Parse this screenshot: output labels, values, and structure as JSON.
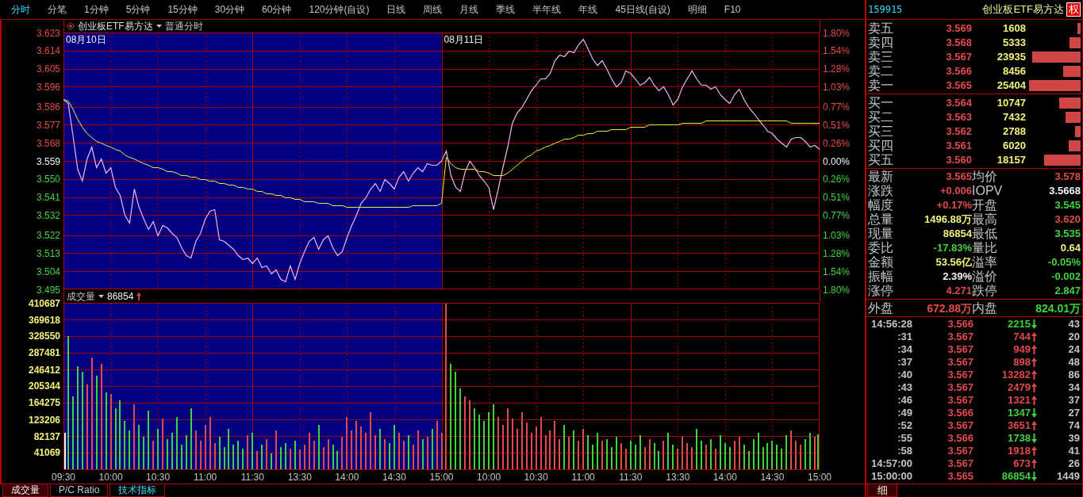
{
  "toolbar": {
    "tabs": [
      {
        "label": "分时",
        "selected": true
      },
      {
        "label": "分笔",
        "selected": false
      },
      {
        "label": "1分钟",
        "selected": false
      },
      {
        "label": "5分钟",
        "selected": false
      },
      {
        "label": "15分钟",
        "selected": false
      },
      {
        "label": "30分钟",
        "selected": false
      },
      {
        "label": "60分钟",
        "selected": false
      },
      {
        "label": "120分钟(自设)",
        "selected": false
      },
      {
        "label": "日线",
        "selected": false
      },
      {
        "label": "周线",
        "selected": false
      },
      {
        "label": "月线",
        "selected": false
      },
      {
        "label": "季线",
        "selected": false
      },
      {
        "label": "半年线",
        "selected": false
      },
      {
        "label": "年线",
        "selected": false
      },
      {
        "label": "45日线(自设)",
        "selected": false
      },
      {
        "label": "明细",
        "selected": false
      },
      {
        "label": "F10",
        "selected": false
      }
    ]
  },
  "price_panel": {
    "title": "创业板ETF易方达",
    "mode": "普通分时",
    "sessions": [
      {
        "date": "08月10日",
        "shaded": true
      },
      {
        "date": "08月11日",
        "shaded": false
      }
    ],
    "percent_ticks": [
      {
        "label": "1.80%",
        "kind": "rise"
      },
      {
        "label": "1.54%",
        "kind": "rise"
      },
      {
        "label": "1.28%",
        "kind": "rise"
      },
      {
        "label": "1.03%",
        "kind": "rise"
      },
      {
        "label": "0.77%",
        "kind": "rise"
      },
      {
        "label": "0.51%",
        "kind": "rise"
      },
      {
        "label": "0.26%",
        "kind": "rise"
      },
      {
        "label": "0.00%",
        "kind": "flat"
      },
      {
        "label": "0.26%",
        "kind": "fall"
      },
      {
        "label": "0.51%",
        "kind": "fall"
      },
      {
        "label": "0.77%",
        "kind": "fall"
      },
      {
        "label": "1.03%",
        "kind": "fall"
      },
      {
        "label": "1.28%",
        "kind": "fall"
      },
      {
        "label": "1.54%",
        "kind": "fall"
      },
      {
        "label": "1.80%",
        "kind": "fall"
      }
    ],
    "chart_data": {
      "type": "line",
      "grid": true,
      "ylim": [
        3.495,
        3.623
      ],
      "yticks": [
        {
          "value": 3.623,
          "label": "3.623"
        },
        {
          "value": 3.614,
          "label": "3.614"
        },
        {
          "value": 3.605,
          "label": "3.605"
        },
        {
          "value": 3.596,
          "label": "3.596"
        },
        {
          "value": 3.586,
          "label": "3.586"
        },
        {
          "value": 3.577,
          "label": "3.577"
        },
        {
          "value": 3.568,
          "label": "3.568"
        },
        {
          "value": 3.559,
          "label": "3.559"
        },
        {
          "value": 3.55,
          "label": "3.550"
        },
        {
          "value": 3.541,
          "label": "3.541"
        },
        {
          "value": 3.532,
          "label": "3.532"
        },
        {
          "value": 3.522,
          "label": "3.522"
        },
        {
          "value": 3.513,
          "label": "3.513"
        },
        {
          "value": 3.504,
          "label": "3.504"
        },
        {
          "value": 3.495,
          "label": "3.495"
        }
      ],
      "categories": [
        null,
        null,
        null,
        null,
        null,
        null,
        null,
        null,
        null,
        null,
        null,
        null,
        null,
        null,
        null,
        null,
        null,
        null,
        null,
        null,
        null,
        null,
        null,
        null,
        null,
        null,
        null,
        null,
        null,
        null,
        null,
        null,
        null,
        null,
        null,
        null,
        null,
        null,
        null,
        null,
        null,
        null,
        null,
        null,
        null,
        null,
        null,
        null,
        null,
        null,
        null,
        null,
        null,
        null,
        null,
        null,
        null,
        null,
        null,
        null,
        null,
        null,
        null,
        null,
        null,
        null,
        null,
        null,
        null,
        null,
        null,
        null,
        null,
        null,
        null,
        null,
        null,
        null,
        null,
        null,
        null,
        null,
        null,
        null,
        null,
        null,
        null,
        null,
        null,
        null,
        null,
        null,
        null,
        null,
        null,
        null,
        null,
        null,
        null,
        null,
        null,
        null,
        null,
        null,
        null,
        null,
        null,
        null,
        null,
        null,
        null,
        null,
        null,
        null,
        null,
        null,
        null,
        null,
        null,
        null,
        null,
        null,
        null,
        null,
        null,
        null,
        null,
        null,
        null,
        null,
        null,
        null,
        null,
        null,
        null,
        null,
        null,
        null,
        null,
        null,
        null,
        null,
        null,
        null,
        null,
        null,
        null,
        null,
        null,
        null,
        null,
        null,
        null,
        null,
        null,
        null,
        null,
        null,
        null,
        null,
        null
      ],
      "series": [
        {
          "color": "#f4b4f4",
          "values": [
            3.59,
            3.588,
            3.572,
            3.555,
            3.549,
            3.56,
            3.566,
            3.556,
            3.56,
            3.553,
            3.556,
            3.546,
            3.542,
            3.532,
            3.528,
            3.545,
            3.536,
            3.53,
            3.525,
            3.529,
            3.522,
            3.527,
            3.526,
            3.523,
            3.521,
            3.516,
            3.512,
            3.511,
            3.519,
            3.523,
            3.53,
            3.534,
            3.535,
            3.52,
            3.519,
            3.517,
            3.515,
            3.512,
            3.51,
            3.511,
            3.508,
            3.511,
            3.506,
            3.507,
            3.503,
            3.505,
            3.5,
            3.499,
            3.507,
            3.5,
            3.508,
            3.514,
            3.519,
            3.521,
            3.515,
            3.52,
            3.522,
            3.516,
            3.512,
            3.514,
            3.521,
            3.527,
            3.532,
            3.538,
            3.541,
            3.545,
            3.548,
            3.544,
            3.55,
            3.548,
            3.545,
            3.551,
            3.554,
            3.549,
            3.553,
            3.556,
            3.554,
            3.558,
            3.557,
            3.557,
            3.559,
            3.564,
            3.552,
            3.546,
            3.544,
            3.554,
            3.559,
            3.556,
            3.552,
            3.549,
            3.546,
            3.535,
            3.545,
            3.556,
            3.566,
            3.578,
            3.583,
            3.586,
            3.59,
            3.594,
            3.597,
            3.6,
            3.6,
            3.603,
            3.609,
            3.612,
            3.611,
            3.614,
            3.613,
            3.617,
            3.62,
            3.615,
            3.61,
            3.607,
            3.609,
            3.605,
            3.6,
            3.596,
            3.598,
            3.604,
            3.603,
            3.6,
            3.597,
            3.598,
            3.601,
            3.597,
            3.594,
            3.596,
            3.592,
            3.587,
            3.59,
            3.596,
            3.6,
            3.604,
            3.6,
            3.597,
            3.597,
            3.595,
            3.596,
            3.592,
            3.59,
            3.588,
            3.592,
            3.595,
            3.59,
            3.586,
            3.583,
            3.58,
            3.577,
            3.574,
            3.573,
            3.57,
            3.568,
            3.566,
            3.57,
            3.571,
            3.571,
            3.569,
            3.566,
            3.567,
            3.565
          ]
        },
        {
          "color": "#f0f040",
          "values": [
            3.59,
            3.589,
            3.585,
            3.58,
            3.576,
            3.573,
            3.571,
            3.569,
            3.568,
            3.567,
            3.566,
            3.565,
            3.564,
            3.562,
            3.561,
            3.56,
            3.559,
            3.558,
            3.557,
            3.556,
            3.556,
            3.555,
            3.554,
            3.554,
            3.553,
            3.552,
            3.552,
            3.551,
            3.551,
            3.55,
            3.55,
            3.549,
            3.549,
            3.548,
            3.548,
            3.547,
            3.547,
            3.546,
            3.546,
            3.545,
            3.545,
            3.544,
            3.544,
            3.543,
            3.543,
            3.542,
            3.542,
            3.541,
            3.541,
            3.54,
            3.54,
            3.539,
            3.539,
            3.539,
            3.538,
            3.538,
            3.538,
            3.537,
            3.537,
            3.537,
            3.536,
            3.536,
            3.536,
            3.536,
            3.536,
            3.536,
            3.536,
            3.536,
            3.536,
            3.536,
            3.536,
            3.536,
            3.536,
            3.536,
            3.537,
            3.537,
            3.537,
            3.537,
            3.537,
            3.537,
            3.538,
            3.561,
            3.558,
            3.556,
            3.555,
            3.555,
            3.555,
            3.555,
            3.554,
            3.554,
            3.553,
            3.552,
            3.552,
            3.552,
            3.553,
            3.555,
            3.557,
            3.559,
            3.561,
            3.562,
            3.564,
            3.565,
            3.566,
            3.567,
            3.568,
            3.569,
            3.57,
            3.57,
            3.571,
            3.572,
            3.572,
            3.573,
            3.573,
            3.574,
            3.574,
            3.574,
            3.575,
            3.575,
            3.575,
            3.575,
            3.576,
            3.576,
            3.576,
            3.576,
            3.577,
            3.577,
            3.577,
            3.577,
            3.577,
            3.577,
            3.577,
            3.578,
            3.578,
            3.578,
            3.578,
            3.578,
            3.579,
            3.579,
            3.579,
            3.579,
            3.579,
            3.579,
            3.579,
            3.579,
            3.579,
            3.579,
            3.579,
            3.579,
            3.579,
            3.579,
            3.579,
            3.579,
            3.579,
            3.579,
            3.578,
            3.578,
            3.578,
            3.578,
            3.578,
            3.578,
            3.578
          ]
        }
      ]
    }
  },
  "volume_panel": {
    "title": "成交量",
    "value": "86854",
    "chart_data": {
      "type": "bar",
      "grid": true,
      "ylim": [
        0,
        410687
      ],
      "yticks": [
        410687,
        369618,
        328550,
        287481,
        246412,
        205344,
        164275,
        123206,
        82137,
        41069
      ],
      "categories": [
        "09:30",
        null,
        null,
        null,
        null,
        null,
        null,
        null,
        null,
        null,
        "10:00",
        null,
        null,
        null,
        null,
        null,
        null,
        null,
        null,
        null,
        "10:30",
        null,
        null,
        null,
        null,
        null,
        null,
        null,
        null,
        null,
        "11:00",
        null,
        null,
        null,
        null,
        null,
        null,
        null,
        null,
        null,
        "11:30",
        null,
        null,
        null,
        null,
        null,
        null,
        null,
        null,
        null,
        "13:30",
        null,
        null,
        null,
        null,
        null,
        null,
        null,
        null,
        null,
        "14:00",
        null,
        null,
        null,
        null,
        null,
        null,
        null,
        null,
        null,
        "14:30",
        null,
        null,
        null,
        null,
        null,
        null,
        null,
        null,
        null,
        "15:00",
        null,
        null,
        null,
        null,
        null,
        null,
        null,
        null,
        null,
        "10:00",
        null,
        null,
        null,
        null,
        null,
        null,
        null,
        null,
        null,
        "10:30",
        null,
        null,
        null,
        null,
        null,
        null,
        null,
        null,
        null,
        "11:00",
        null,
        null,
        null,
        null,
        null,
        null,
        null,
        null,
        null,
        "11:30",
        null,
        null,
        null,
        null,
        null,
        null,
        null,
        null,
        null,
        "13:30",
        null,
        null,
        null,
        null,
        null,
        null,
        null,
        null,
        null,
        "14:00",
        null,
        null,
        null,
        null,
        null,
        null,
        null,
        null,
        null,
        "14:30",
        null,
        null,
        null,
        null,
        null,
        null,
        null,
        null,
        null,
        "15:00"
      ],
      "series": [
        {
          "color": "#e34a4a",
          "values": [
            null,
            null,
            null,
            null,
            null,
            210000,
            275000,
            null,
            260000,
            null,
            185000,
            null,
            null,
            null,
            null,
            160000,
            null,
            null,
            null,
            70000,
            null,
            125000,
            null,
            null,
            null,
            null,
            null,
            null,
            95000,
            70000,
            110000,
            130000,
            65000,
            null,
            null,
            null,
            null,
            null,
            null,
            85000,
            null,
            45000,
            null,
            75000,
            null,
            95000,
            null,
            null,
            50000,
            null,
            48000,
            60000,
            90000,
            70000,
            null,
            55000,
            75000,
            null,
            null,
            80000,
            130000,
            95000,
            120000,
            105000,
            90000,
            140000,
            85000,
            null,
            75000,
            null,
            null,
            90000,
            70000,
            null,
            60000,
            95000,
            null,
            80000,
            null,
            120000,
            90000,
            410000,
            null,
            null,
            null,
            180000,
            170000,
            null,
            null,
            null,
            null,
            null,
            130000,
            110000,
            150000,
            125000,
            100000,
            140000,
            115000,
            90000,
            105000,
            130000,
            85000,
            95000,
            120000,
            75000,
            null,
            80000,
            null,
            70000,
            100000,
            null,
            null,
            null,
            70000,
            null,
            null,
            null,
            65000,
            50000,
            null,
            null,
            null,
            55000,
            75000,
            null,
            null,
            70000,
            null,
            null,
            50000,
            80000,
            65000,
            55000,
            null,
            null,
            60000,
            null,
            50000,
            null,
            null,
            null,
            70000,
            80000,
            null,
            null,
            null,
            null,
            null,
            null,
            null,
            null,
            null,
            null,
            95000,
            70000,
            60000,
            null,
            null,
            80000,
            null
          ]
        },
        {
          "color": "#3fd23f",
          "values": [
            null,
            328000,
            180000,
            255000,
            240000,
            null,
            null,
            230000,
            null,
            190000,
            null,
            150000,
            170000,
            120000,
            95000,
            null,
            110000,
            80000,
            145000,
            null,
            100000,
            null,
            75000,
            90000,
            130000,
            60000,
            85000,
            150000,
            null,
            null,
            null,
            null,
            null,
            80000,
            55000,
            100000,
            60000,
            70000,
            50000,
            null,
            90000,
            null,
            60000,
            null,
            40000,
            null,
            55000,
            65000,
            null,
            70000,
            null,
            null,
            null,
            null,
            110000,
            null,
            null,
            60000,
            45000,
            null,
            null,
            null,
            null,
            null,
            null,
            null,
            null,
            100000,
            null,
            65000,
            110000,
            null,
            null,
            85000,
            null,
            null,
            75000,
            null,
            100000,
            null,
            null,
            null,
            260000,
            240000,
            200000,
            null,
            null,
            150000,
            135000,
            120000,
            140000,
            160000,
            null,
            null,
            null,
            null,
            null,
            null,
            null,
            null,
            null,
            null,
            null,
            null,
            null,
            null,
            110000,
            null,
            95000,
            null,
            null,
            85000,
            60000,
            90000,
            null,
            75000,
            55000,
            80000,
            null,
            null,
            70000,
            60000,
            85000,
            null,
            null,
            65000,
            45000,
            null,
            90000,
            60000,
            null,
            null,
            null,
            null,
            100000,
            70000,
            null,
            75000,
            null,
            85000,
            65000,
            55000,
            null,
            null,
            60000,
            45000,
            75000,
            90000,
            55000,
            65000,
            70000,
            60000,
            50000,
            85000,
            null,
            null,
            null,
            75000,
            90000,
            null,
            87000
          ]
        },
        {
          "color": "#f4f4f4",
          "values": [
            90000,
            null,
            null,
            null,
            null,
            null,
            null,
            null,
            null,
            null,
            null,
            null,
            null,
            null,
            null,
            null,
            null,
            null,
            null,
            null,
            null,
            null,
            null,
            null,
            null,
            null,
            null,
            null,
            null,
            null,
            null,
            null,
            null,
            null,
            null,
            null,
            null,
            null,
            null,
            null,
            null,
            null,
            null,
            null,
            null,
            null,
            null,
            null,
            null,
            null,
            null,
            null,
            null,
            null,
            null,
            null,
            null,
            null,
            null,
            null,
            null,
            null,
            null,
            null,
            null,
            null,
            null,
            null,
            null,
            null,
            null,
            null,
            null,
            null,
            null,
            null,
            null,
            null,
            null,
            null,
            null,
            null,
            null,
            null,
            null,
            null,
            null,
            null,
            null,
            null,
            null,
            null,
            null,
            null,
            null,
            null,
            null,
            null,
            null,
            null,
            null,
            null,
            null,
            null,
            null,
            null,
            null,
            null,
            null,
            null,
            null,
            null,
            null,
            null,
            null,
            null,
            null,
            null,
            null,
            null,
            null,
            null,
            null,
            null,
            null,
            null,
            null,
            null,
            null,
            null,
            null,
            null,
            null,
            null,
            null,
            null,
            null,
            null,
            null,
            null,
            null,
            null,
            null,
            null,
            null,
            null,
            null,
            null,
            null,
            null,
            null,
            null,
            null,
            null,
            null,
            null,
            null,
            null,
            null,
            null,
            null
          ]
        }
      ]
    }
  },
  "bottom_tabs": [
    {
      "label": "成交量",
      "selected": true,
      "kind": "tab"
    },
    {
      "label": "P/C Ratio",
      "selected": false,
      "kind": "tab"
    },
    {
      "label": "技术指标",
      "selected": false,
      "kind": "menu"
    }
  ],
  "quote": {
    "code": "159915",
    "name": "创业板ETF易方达",
    "badge": "权",
    "asks": [
      {
        "label": "卖五",
        "price": "3.569",
        "volume": "1608",
        "level": 0.063
      },
      {
        "label": "卖四",
        "price": "3.568",
        "volume": "5333",
        "level": 0.21
      },
      {
        "label": "卖三",
        "price": "3.567",
        "volume": "23935",
        "level": 0.942
      },
      {
        "label": "卖二",
        "price": "3.566",
        "volume": "8456",
        "level": 0.333
      },
      {
        "label": "卖一",
        "price": "3.565",
        "volume": "25404",
        "level": 1
      }
    ],
    "bids": [
      {
        "label": "买一",
        "price": "3.564",
        "volume": "10747",
        "level": 0.423
      },
      {
        "label": "买二",
        "price": "3.563",
        "volume": "7432",
        "level": 0.293
      },
      {
        "label": "买三",
        "price": "3.562",
        "volume": "2788",
        "level": 0.11
      },
      {
        "label": "买四",
        "price": "3.561",
        "volume": "6020",
        "level": 0.237
      },
      {
        "label": "买五",
        "price": "3.560",
        "volume": "18157",
        "level": 0.715
      }
    ],
    "stats": [
      {
        "label": "最新",
        "value": "3.565",
        "color": "#e34a4a"
      },
      {
        "label": "均价",
        "value": "3.578",
        "color": "#e34a4a"
      },
      {
        "label": "涨跌",
        "value": "+0.006",
        "color": "#e34a4a"
      },
      {
        "label": "IOPV",
        "value": "3.5668",
        "color": "#f4f4f4"
      },
      {
        "label": "幅度",
        "value": "+0.17%",
        "color": "#e34a4a"
      },
      {
        "label": "开盘",
        "value": "3.545",
        "color": "#3fd23f"
      },
      {
        "label": "总量",
        "value": "1496.88万",
        "color": "#f2f27a"
      },
      {
        "label": "最高",
        "value": "3.620",
        "color": "#e34a4a"
      },
      {
        "label": "现量",
        "value": "86854",
        "color": "#f2f27a"
      },
      {
        "label": "最低",
        "value": "3.535",
        "color": "#3fd23f"
      },
      {
        "label": "委比",
        "value": "-17.83%",
        "color": "#3fd23f"
      },
      {
        "label": "量比",
        "value": "0.64",
        "color": "#f2f27a"
      },
      {
        "label": "金额",
        "value": "53.56亿",
        "color": "#f2f27a"
      },
      {
        "label": "溢率",
        "value": "-0.05%",
        "color": "#3fd23f"
      },
      {
        "label": "振幅",
        "value": "2.39%",
        "color": "#f4f4f4"
      },
      {
        "label": "溢价",
        "value": "-0.002",
        "color": "#3fd23f"
      },
      {
        "label": "涨停",
        "value": "4.271",
        "color": "#e34a4a"
      },
      {
        "label": "跌停",
        "value": "2.847",
        "color": "#3fd23f"
      }
    ],
    "flows": [
      {
        "label": "外盘",
        "value": "672.88万",
        "kind": "rise"
      },
      {
        "label": "内盘",
        "value": "824.01万",
        "kind": "fall"
      }
    ],
    "ticks": [
      {
        "time": "14:56:28",
        "price": "3.566",
        "volume": "2215",
        "kind": "down",
        "count": "43"
      },
      {
        "time": ":31",
        "price": "3.567",
        "volume": "744",
        "kind": "up",
        "count": "20"
      },
      {
        "time": ":34",
        "price": "3.567",
        "volume": "949",
        "kind": "up",
        "count": "24"
      },
      {
        "time": ":37",
        "price": "3.567",
        "volume": "898",
        "kind": "up",
        "count": "48"
      },
      {
        "time": ":40",
        "price": "3.567",
        "volume": "13282",
        "kind": "up",
        "count": "86"
      },
      {
        "time": ":43",
        "price": "3.567",
        "volume": "2479",
        "kind": "up",
        "count": "34"
      },
      {
        "time": ":46",
        "price": "3.567",
        "volume": "1321",
        "kind": "up",
        "count": "37"
      },
      {
        "time": ":49",
        "price": "3.566",
        "volume": "1347",
        "kind": "down",
        "count": "27"
      },
      {
        "time": ":52",
        "price": "3.567",
        "volume": "3651",
        "kind": "up",
        "count": "74"
      },
      {
        "time": ":55",
        "price": "3.566",
        "volume": "1738",
        "kind": "down",
        "count": "39"
      },
      {
        "time": ":58",
        "price": "3.567",
        "volume": "1918",
        "kind": "up",
        "count": "41"
      },
      {
        "time": "14:57:00",
        "price": "3.567",
        "volume": "673",
        "kind": "up",
        "count": "26"
      },
      {
        "time": "15:00:00",
        "price": "3.565",
        "volume": "86854",
        "kind": "down",
        "count": "1449"
      }
    ],
    "detail_tab": {
      "label": "细",
      "selected": true
    }
  }
}
